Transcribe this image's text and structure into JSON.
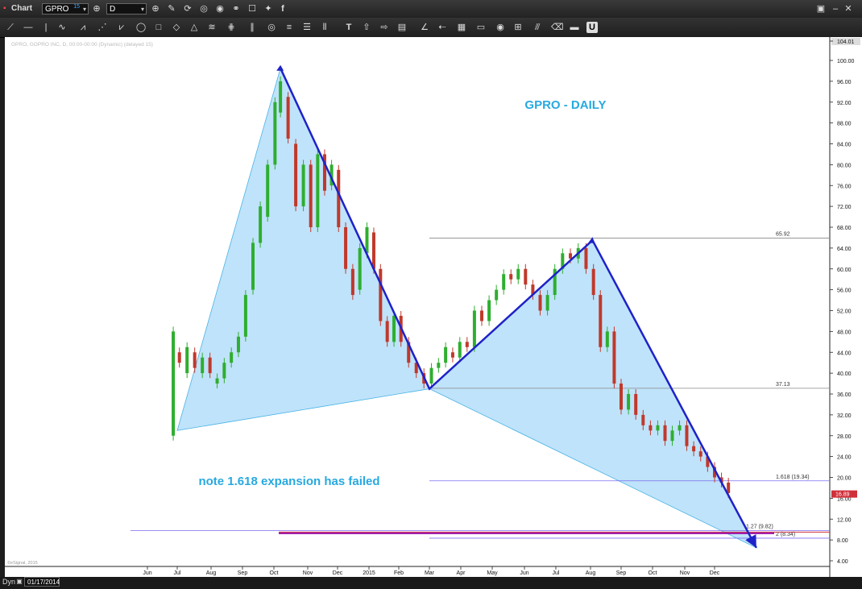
{
  "window": {
    "title": "Chart"
  },
  "toolbar": {
    "symbol": "GPRO",
    "interval": "D",
    "symbol_superscript": "15"
  },
  "chart_info_line": "GPRO, GOPRO INC, D, 00:00-00:00 (Dynamic) (delayed 15)",
  "copyright": "©eSignal, 2015",
  "bottom": {
    "mode": "Dyn",
    "date": "01/17/2014"
  },
  "colors": {
    "up_candle": "#2fae2f",
    "down_candle": "#c0392b",
    "pattern_fill": "#bfe3fa",
    "pattern_line": "#1e22c8",
    "title_text": "#28a9e0",
    "fib_line": "#7a6cf0",
    "red_line": "#d0303a",
    "magenta_line": "#9b0fa8"
  },
  "chart_data": {
    "type": "candlestick",
    "title": "GPRO - DAILY",
    "annotation": "note 1.618 expansion has failed",
    "price_axis": {
      "labels": [
        "104.01",
        "100.00",
        "96.00",
        "92.00",
        "88.00",
        "84.00",
        "80.00",
        "76.00",
        "72.00",
        "68.00",
        "64.00",
        "60.00",
        "56.00",
        "52.00",
        "48.00",
        "44.00",
        "40.00",
        "36.00",
        "32.00",
        "28.00",
        "24.00",
        "20.00",
        "16.00",
        "12.00",
        "8.00",
        "4.00"
      ],
      "last_price": "16.89",
      "ylim": [
        2,
        105
      ]
    },
    "time_axis": {
      "labels": [
        "Jun",
        "Jul",
        "Aug",
        "Sep",
        "Oct",
        "Nov",
        "Dec",
        "2015",
        "Feb",
        "Mar",
        "Apr",
        "May",
        "Jun",
        "Jul",
        "Aug",
        "Sep",
        "Oct",
        "Nov",
        "Dec"
      ]
    },
    "pattern_points": [
      {
        "date": "2014-07-01",
        "price": 29
      },
      {
        "date": "2014-10-07",
        "price": 98.5
      },
      {
        "date": "2015-03-01",
        "price": 37
      },
      {
        "date": "2015-08-03",
        "price": 65.5
      },
      {
        "date": "2016-01-12",
        "price": 6.5
      }
    ],
    "fib_levels": [
      {
        "label": "65.92",
        "price": 65.9,
        "from": "2015-03-01"
      },
      {
        "label": "37.13",
        "price": 37.1,
        "from": "2015-03-01"
      },
      {
        "label": "1.618 (19.34)",
        "price": 19.34,
        "from": "2015-03-01"
      },
      {
        "label": "1.27 (9.82)",
        "price": 9.82,
        "from": "2014-05-15"
      },
      {
        "label": "2 (8.34)",
        "price": 8.34,
        "from": "2015-03-01"
      }
    ],
    "red_line_price": 9.5,
    "candles_approx": [
      [
        "2014-06-27",
        28,
        48
      ],
      [
        "2014-07-03",
        44,
        42
      ],
      [
        "2014-07-10",
        40,
        45
      ],
      [
        "2014-07-17",
        44,
        41
      ],
      [
        "2014-07-24",
        40,
        43
      ],
      [
        "2014-07-31",
        43,
        40
      ],
      [
        "2014-08-07",
        38,
        39
      ],
      [
        "2014-08-14",
        39,
        42
      ],
      [
        "2014-08-21",
        42,
        44
      ],
      [
        "2014-08-28",
        44,
        47
      ],
      [
        "2014-09-04",
        47,
        55
      ],
      [
        "2014-09-11",
        56,
        65
      ],
      [
        "2014-09-18",
        65,
        72
      ],
      [
        "2014-09-25",
        70,
        80
      ],
      [
        "2014-10-02",
        80,
        92
      ],
      [
        "2014-10-07",
        90,
        96
      ],
      [
        "2014-10-14",
        93,
        85
      ],
      [
        "2014-10-21",
        84,
        72
      ],
      [
        "2014-10-28",
        72,
        80
      ],
      [
        "2014-11-04",
        80,
        68
      ],
      [
        "2014-11-11",
        68,
        82
      ],
      [
        "2014-11-18",
        82,
        75
      ],
      [
        "2014-11-25",
        76,
        80
      ],
      [
        "2014-12-02",
        79,
        68
      ],
      [
        "2014-12-09",
        68,
        60
      ],
      [
        "2014-12-16",
        60,
        55
      ],
      [
        "2014-12-23",
        56,
        64
      ],
      [
        "2014-12-30",
        63,
        68
      ],
      [
        "2015-01-06",
        67,
        60
      ],
      [
        "2015-01-13",
        60,
        50
      ],
      [
        "2015-01-20",
        50,
        46
      ],
      [
        "2015-01-27",
        46,
        51
      ],
      [
        "2015-02-03",
        51,
        46
      ],
      [
        "2015-02-10",
        46,
        42
      ],
      [
        "2015-02-17",
        42,
        40
      ],
      [
        "2015-02-24",
        40,
        38
      ],
      [
        "2015-03-03",
        38,
        41
      ],
      [
        "2015-03-10",
        41,
        42
      ],
      [
        "2015-03-17",
        42,
        45
      ],
      [
        "2015-03-24",
        44,
        43
      ],
      [
        "2015-03-31",
        43,
        46
      ],
      [
        "2015-04-07",
        46,
        45
      ],
      [
        "2015-04-14",
        45,
        52
      ],
      [
        "2015-04-21",
        52,
        50
      ],
      [
        "2015-04-28",
        50,
        54
      ],
      [
        "2015-05-05",
        54,
        56
      ],
      [
        "2015-05-12",
        56,
        59
      ],
      [
        "2015-05-19",
        59,
        58
      ],
      [
        "2015-05-26",
        58,
        60
      ],
      [
        "2015-06-02",
        60,
        57
      ],
      [
        "2015-06-09",
        57,
        55
      ],
      [
        "2015-06-16",
        55,
        52
      ],
      [
        "2015-06-23",
        52,
        55
      ],
      [
        "2015-06-30",
        55,
        60
      ],
      [
        "2015-07-07",
        60,
        63
      ],
      [
        "2015-07-14",
        63,
        62
      ],
      [
        "2015-07-21",
        62,
        64
      ],
      [
        "2015-07-28",
        64,
        60
      ],
      [
        "2015-08-04",
        60,
        55
      ],
      [
        "2015-08-11",
        55,
        45
      ],
      [
        "2015-08-18",
        45,
        48
      ],
      [
        "2015-08-25",
        48,
        38
      ],
      [
        "2015-09-01",
        38,
        33
      ],
      [
        "2015-09-08",
        33,
        36
      ],
      [
        "2015-09-15",
        36,
        32
      ],
      [
        "2015-09-22",
        32,
        30
      ],
      [
        "2015-09-29",
        30,
        29
      ],
      [
        "2015-10-06",
        29,
        30
      ],
      [
        "2015-10-13",
        30,
        27
      ],
      [
        "2015-10-20",
        27,
        29
      ],
      [
        "2015-10-27",
        29,
        30
      ],
      [
        "2015-11-03",
        30,
        26
      ],
      [
        "2015-11-10",
        26,
        25
      ],
      [
        "2015-11-17",
        25,
        24
      ],
      [
        "2015-11-24",
        24,
        22
      ],
      [
        "2015-12-01",
        22,
        20
      ],
      [
        "2015-12-08",
        20,
        19
      ],
      [
        "2015-12-15",
        19,
        17
      ]
    ]
  }
}
